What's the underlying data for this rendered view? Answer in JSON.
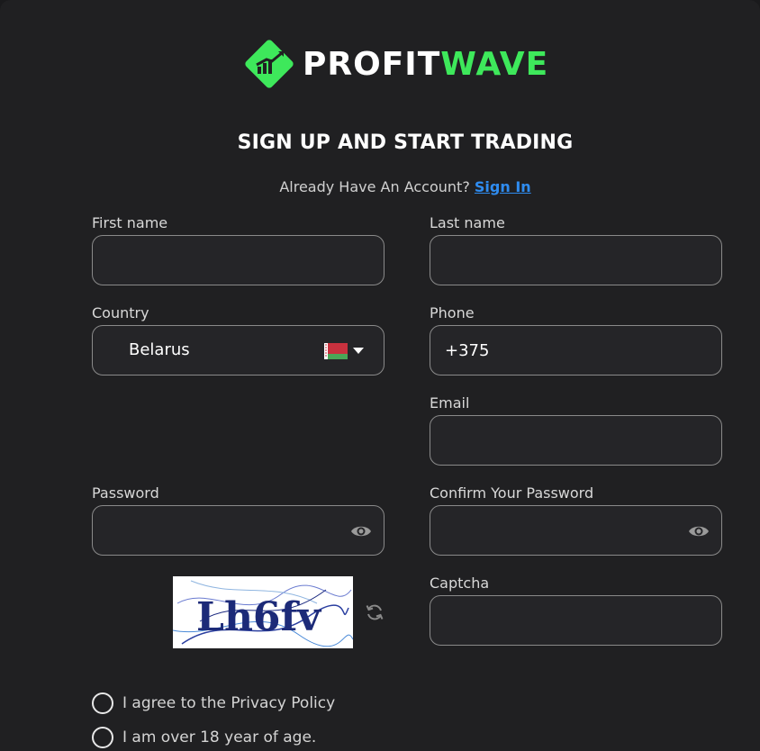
{
  "brand": {
    "part1": "PROFIT",
    "part2": "WAVE",
    "accent": "#3ee85b"
  },
  "heading": "SIGN UP AND START TRADING",
  "account_prompt": {
    "text": "Already Have An Account?",
    "link": "Sign In"
  },
  "form": {
    "first_name": {
      "label": "First name",
      "value": ""
    },
    "last_name": {
      "label": "Last name",
      "value": ""
    },
    "country": {
      "label": "Country",
      "value": "Belarus",
      "flag_icon": "belarus-flag-icon"
    },
    "phone": {
      "label": "Phone",
      "value": "+375"
    },
    "email": {
      "label": "Email",
      "value": ""
    },
    "password": {
      "label": "Password",
      "value": ""
    },
    "confirm_password": {
      "label": "Confirm Your Password",
      "value": ""
    },
    "captcha": {
      "label": "Captcha",
      "value": "",
      "image_text": "Lh6fv"
    }
  },
  "checkboxes": {
    "privacy": "I agree to the Privacy Policy",
    "age": "I am over 18 year of age."
  }
}
